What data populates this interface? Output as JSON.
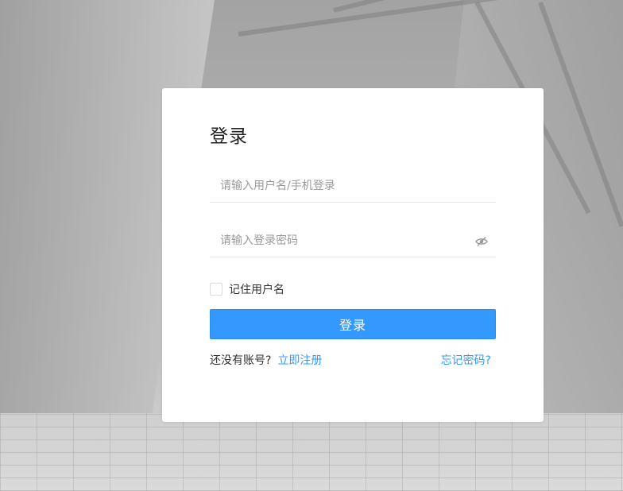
{
  "login": {
    "title": "登录",
    "username_placeholder": "请输入用户名/手机登录",
    "password_placeholder": "请输入登录密码",
    "remember_label": "记住用户名",
    "submit_label": "登录",
    "no_account_text": "还没有账号?",
    "register_link": "立即注册",
    "forgot_link": "忘记密码?"
  },
  "theme": {
    "accent": "#3399ff",
    "card_bg": "#ffffff"
  },
  "icons": {
    "password_toggle": "eye-hidden-icon"
  }
}
